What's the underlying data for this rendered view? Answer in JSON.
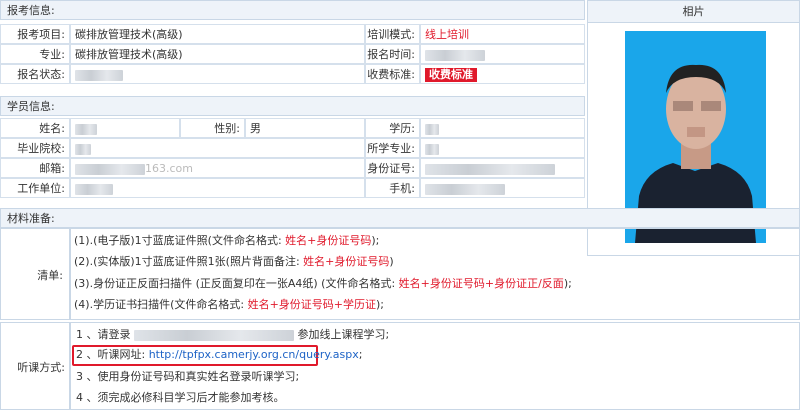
{
  "exam": {
    "section_title": "报考信息:",
    "project_label": "报考项目:",
    "project_value": "碳排放管理技术(高级)",
    "major_label": "专业:",
    "major_value": "碳排放管理技术(高级)",
    "status_label": "报名状态:",
    "mode_label": "培训模式:",
    "mode_value": "线上培训",
    "time_label": "报名时间:",
    "fee_label": "收费标准:",
    "fee_value": "收费标准"
  },
  "photo": {
    "title": "相片"
  },
  "student": {
    "section_title": "学员信息:",
    "name_label": "姓名:",
    "gender_label": "性别:",
    "gender_value": "男",
    "edu_label": "学历:",
    "school_label": "毕业院校:",
    "major_label": "所学专业:",
    "email_label": "邮箱:",
    "email_tail": "163.com",
    "id_label": "身份证号:",
    "company_label": "工作单位:",
    "phone_label": "手机:"
  },
  "materials": {
    "section_title": "材料准备:",
    "list_label": "清单:",
    "items": [
      {
        "text": "(1).(电子版)1寸蓝底证件照(文件命名格式: ",
        "red": "姓名+身份证号码",
        "tail": ");"
      },
      {
        "text": "(2).(实体版)1寸蓝底证件照1张(照片背面备注: ",
        "red": "姓名+身份证号码",
        "tail": ")"
      },
      {
        "text": "(3).身份证正反面扫描件  (正反面复印在一张A4纸)  (文件命名格式: ",
        "red": "姓名+身份证号码+身份证正/反面",
        "tail": ");"
      },
      {
        "text": "(4).学历证书扫描件(文件命名格式: ",
        "red": "姓名+身份证号码+学历证",
        "tail": ");"
      }
    ]
  },
  "listen": {
    "label": "听课方式:",
    "line1_prefix": "1 、请登录",
    "line1_suffix": "参加线上课程学习;",
    "line2_prefix": "2 、听课网址: ",
    "line2_url": "http://tpfpx.camerjy.org.cn/query.aspx",
    "line2_suffix": ";",
    "line3": "3 、使用身份证号码和真实姓名登录听课学习;",
    "line4": "4 、须完成必修科目学习后才能参加考核。"
  },
  "colors": {
    "accent_red": "#e0192b",
    "link_blue": "#1d63c6",
    "header_bg": "#eef3f9",
    "border": "#c9d7e6",
    "photo_bg": "#1aa6ea"
  }
}
